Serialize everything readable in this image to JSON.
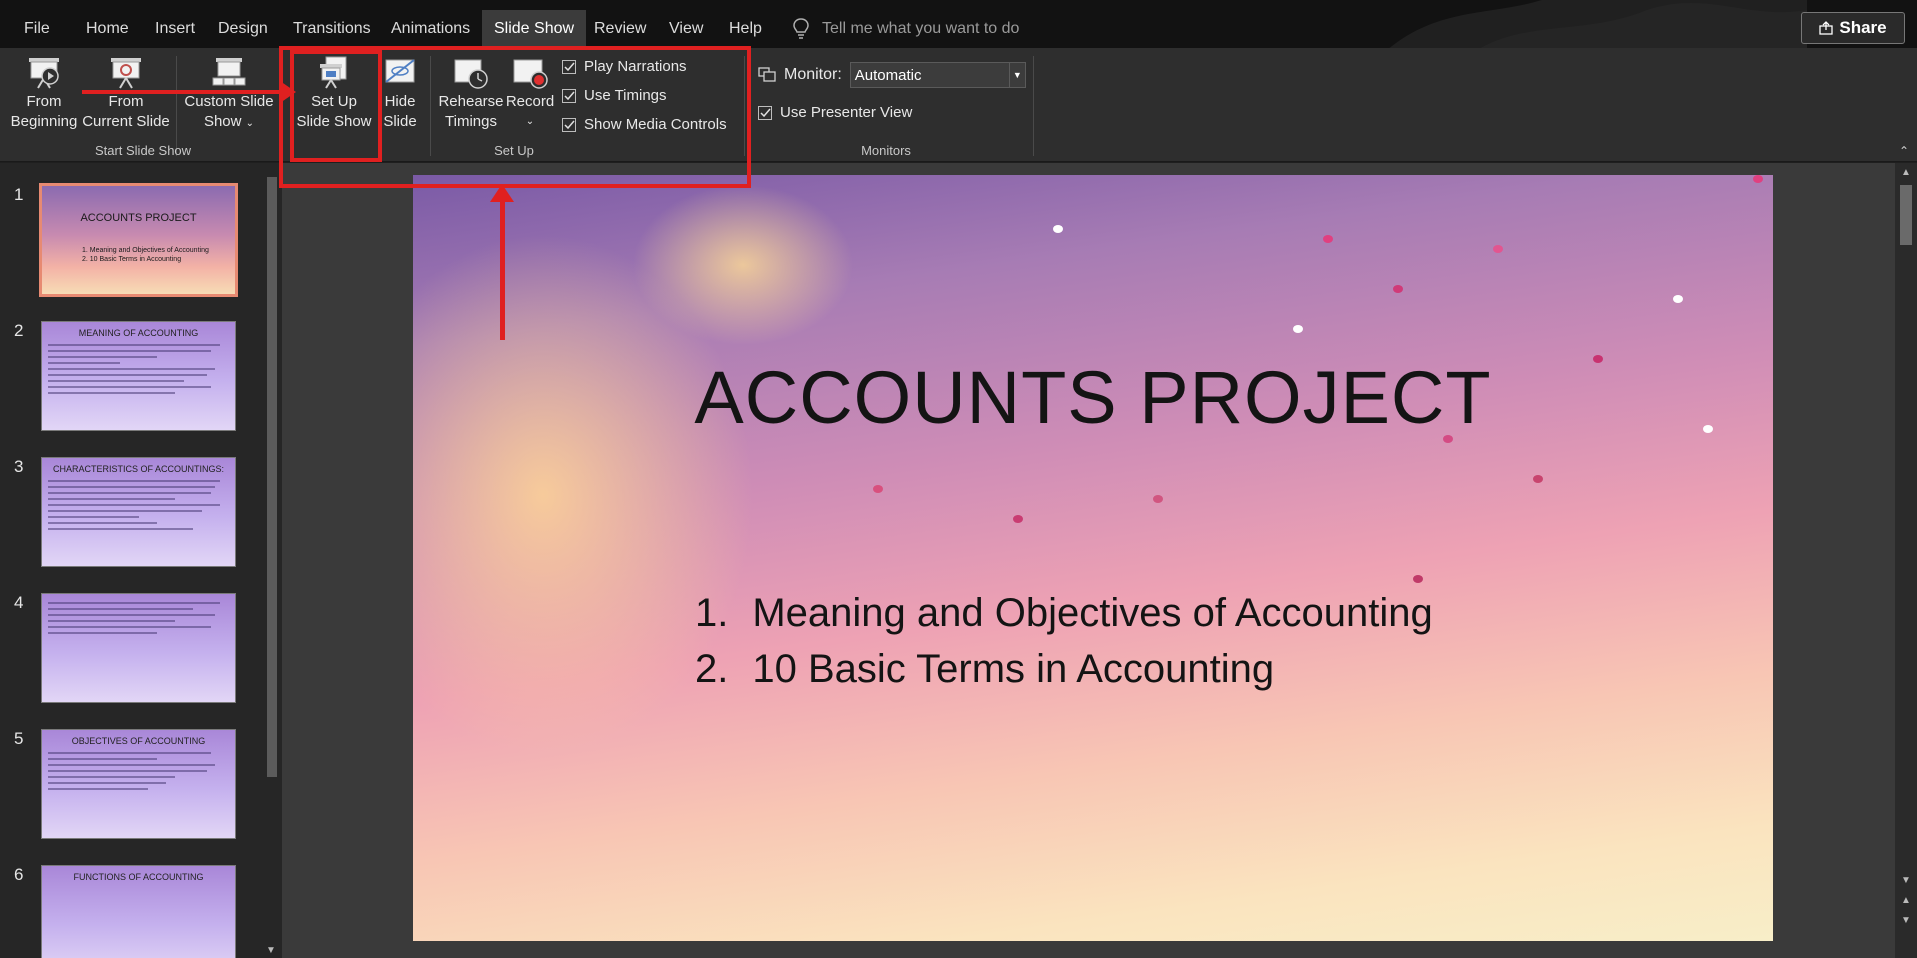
{
  "tabs": [
    {
      "label": "File",
      "active": false
    },
    {
      "label": "Home",
      "active": false
    },
    {
      "label": "Insert",
      "active": false
    },
    {
      "label": "Design",
      "active": false
    },
    {
      "label": "Transitions",
      "active": false
    },
    {
      "label": "Animations",
      "active": false
    },
    {
      "label": "Slide Show",
      "active": true
    },
    {
      "label": "Review",
      "active": false
    },
    {
      "label": "View",
      "active": false
    },
    {
      "label": "Help",
      "active": false
    }
  ],
  "tell_me": {
    "placeholder": "Tell me what you want to do",
    "icon": "lightbulb-icon"
  },
  "share": {
    "label": "Share",
    "icon": "share-icon"
  },
  "ribbon": {
    "start_group": {
      "label": "Start Slide Show",
      "from_beginning": {
        "line1": "From",
        "line2": "Beginning"
      },
      "from_current": {
        "line1": "From",
        "line2": "Current Slide"
      },
      "custom": {
        "line1": "Custom Slide",
        "line2": "Show"
      }
    },
    "setup_group": {
      "label": "Set Up",
      "setup_show": {
        "line1": "Set Up",
        "line2": "Slide Show"
      },
      "hide_slide": {
        "line1": "Hide",
        "line2": "Slide"
      },
      "rehearse": {
        "line1": "Rehearse",
        "line2": "Timings"
      },
      "record": {
        "line1": "Record"
      },
      "checkboxes": [
        {
          "label": "Play Narrations",
          "checked": true
        },
        {
          "label": "Use Timings",
          "checked": true
        },
        {
          "label": "Show Media Controls",
          "checked": true
        }
      ]
    },
    "monitors_group": {
      "label": "Monitors",
      "monitor_label": "Monitor:",
      "monitor_value": "Automatic",
      "presenter_view": {
        "label": "Use Presenter View",
        "checked": true
      }
    }
  },
  "slides": [
    {
      "num": "1",
      "title": "ACCOUNTS PROJECT",
      "items": [
        "1.  Meaning and Objectives of Accounting",
        "2.  10 Basic Terms in Accounting"
      ]
    },
    {
      "num": "2",
      "title": "MEANING OF ACCOUNTING"
    },
    {
      "num": "3",
      "title": "CHARACTERISTICS OF ACCOUNTINGS:"
    },
    {
      "num": "4",
      "title": ""
    },
    {
      "num": "5",
      "title": "OBJECTIVES OF ACCOUNTING"
    },
    {
      "num": "6",
      "title": "FUNCTIONS OF ACCOUNTING"
    }
  ],
  "main_slide": {
    "title": "ACCOUNTS PROJECT",
    "items": [
      {
        "num": "1.",
        "text": "Meaning and Objectives of Accounting"
      },
      {
        "num": "2.",
        "text": "10 Basic Terms in Accounting"
      }
    ]
  },
  "colors": {
    "annotation": "#e02020",
    "active_tab": "#3b3b3b",
    "selected_thumb": "#e78a72"
  }
}
